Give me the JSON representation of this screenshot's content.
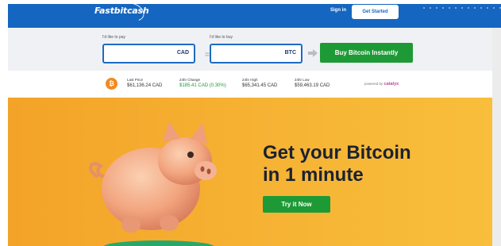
{
  "brand": {
    "logo_text": "Fastbitcash"
  },
  "nav": {
    "signin_label": "Sign in",
    "getstarted_label": "Get Started"
  },
  "converter": {
    "pay_label": "I'd like to pay",
    "buy_label": "I'd like to buy",
    "pay_value": "",
    "buy_value": "",
    "pay_currency": "CAD",
    "buy_currency": "BTC",
    "equals": "=",
    "buy_button_label": "Buy Bitcoin Instantly"
  },
  "stats": {
    "coin_symbol": "₿",
    "items": [
      {
        "label": "Last Price",
        "value": "$61,136.24 CAD"
      },
      {
        "label": "24hr Change",
        "value": "$185.41 CAD (0.30%)"
      },
      {
        "label": "24hr High",
        "value": "$65,341.45 CAD"
      },
      {
        "label": "24hr Low",
        "value": "$59,463.19 CAD"
      }
    ],
    "powered_by_label": "powered by",
    "powered_by_brand": "catalyx"
  },
  "hero": {
    "title_line1": "Get your Bitcoin",
    "title_line2": "in 1 minute",
    "cta_label": "Try it Now"
  },
  "colors": {
    "nav_blue": "#1566c0",
    "green": "#1d9a35",
    "hero_orange": "#f5ad30",
    "bitcoin_orange": "#f08a24"
  },
  "icons": [
    "bitcoin-icon",
    "arrow-right-icon",
    "piggy-bank-illustration"
  ]
}
